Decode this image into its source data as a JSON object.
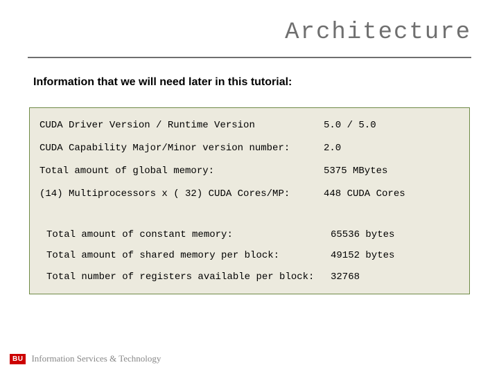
{
  "title": "Architecture",
  "intro": "Information that we will need later in this tutorial:",
  "group_a": [
    {
      "label": "CUDA Driver Version / Runtime Version",
      "value": "5.0 / 5.0"
    },
    {
      "label": "CUDA Capability Major/Minor version number:",
      "value": "2.0"
    },
    {
      "label": "Total amount of global memory:",
      "value": "5375 MBytes"
    },
    {
      "label": "(14) Multiprocessors x ( 32) CUDA Cores/MP:",
      "value": "448 CUDA Cores"
    }
  ],
  "group_b": [
    {
      "label": "Total amount of constant memory:",
      "value": "65536 bytes"
    },
    {
      "label": "Total amount of shared memory per block:",
      "value": "49152 bytes"
    },
    {
      "label": "Total number of registers available per block:",
      "value": "32768"
    }
  ],
  "footer": {
    "badge": "BU",
    "text": "Information Services & Technology"
  }
}
